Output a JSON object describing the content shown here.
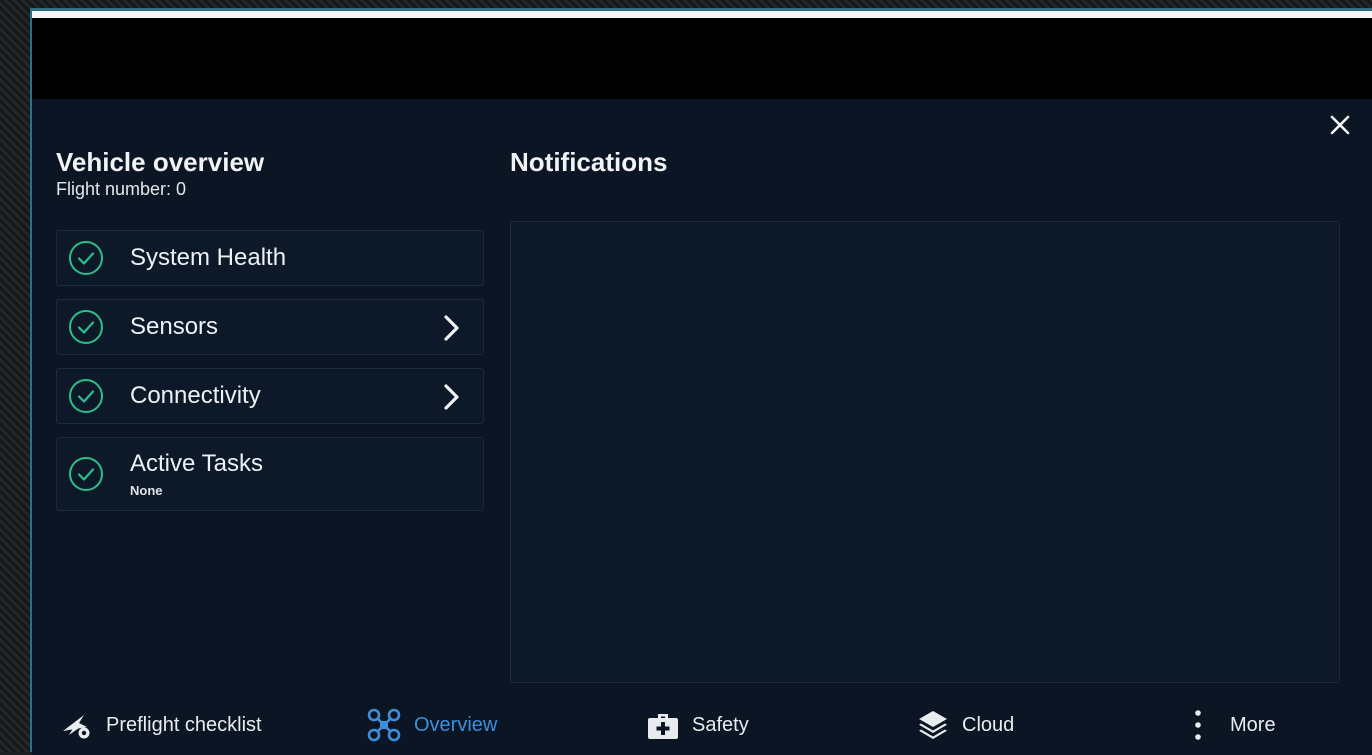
{
  "overview": {
    "title": "Vehicle overview",
    "flight_number": "Flight number: 0",
    "items": [
      {
        "label": "System Health",
        "has_chevron": false,
        "status": "ok"
      },
      {
        "label": "Sensors",
        "has_chevron": true,
        "status": "ok"
      },
      {
        "label": "Connectivity",
        "has_chevron": true,
        "status": "ok"
      },
      {
        "label": "Active Tasks",
        "sublabel": "None",
        "has_chevron": false,
        "status": "ok"
      }
    ]
  },
  "notifications": {
    "title": "Notifications"
  },
  "nav": {
    "items": [
      {
        "label": "Preflight checklist",
        "icon": "takeoff-icon",
        "active": false
      },
      {
        "label": "Overview",
        "icon": "drone-icon",
        "active": true
      },
      {
        "label": "Safety",
        "icon": "first-aid-kit-icon",
        "active": false
      },
      {
        "label": "Cloud",
        "icon": "layers-icon",
        "active": false
      },
      {
        "label": "More",
        "icon": "vertical-dots-icon",
        "active": false
      }
    ]
  },
  "colors": {
    "ok_green": "#2bbf8a",
    "active_blue": "#3d8fdc",
    "panel_bg": "#0c1524"
  }
}
